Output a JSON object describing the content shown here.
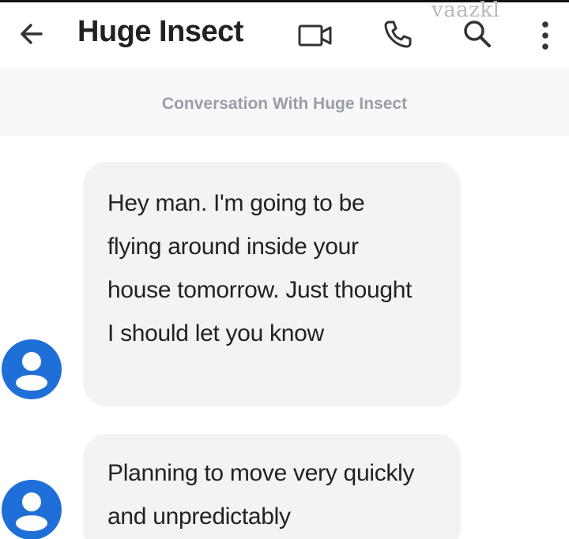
{
  "header": {
    "title": "Huge Insect",
    "back_icon": "arrow-left-icon",
    "actions": [
      "video-call-icon",
      "phone-icon",
      "search-icon",
      "more-vert-icon"
    ]
  },
  "watermark": "vaazkl",
  "conversation": {
    "heading": "Conversation With Huge Insect",
    "messages": [
      {
        "sender": "Huge Insect",
        "text": "Hey man. I'm going to be flying around inside your house tomorrow. Just thought I should let you know"
      },
      {
        "sender": "Huge Insect",
        "text": "Planning to move very quickly and unpredictably"
      }
    ]
  },
  "colors": {
    "avatar_blue": "#1f6fd8",
    "bubble_gray": "#f1f3f4",
    "heading_gray": "#9a9ea5"
  }
}
